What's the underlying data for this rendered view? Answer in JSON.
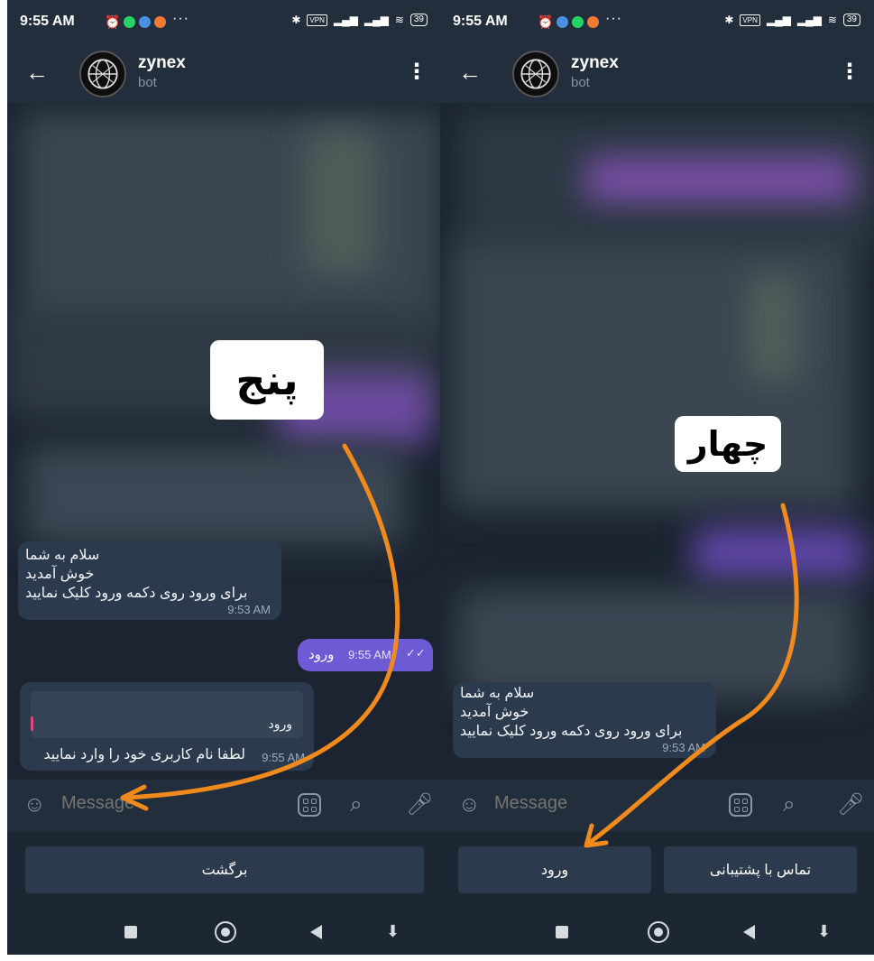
{
  "status_bar": {
    "time": "9:55 AM",
    "more": "···",
    "vpn": "VPN",
    "battery": "39"
  },
  "chat": {
    "name": "zynex",
    "subtitle": "bot"
  },
  "welcome_message": {
    "line1": "سلام به شما",
    "line2": "خوش آمدید",
    "line3": "برای ورود روی دکمه ورود کلیک نمایید",
    "time": "9:53 AM"
  },
  "sent_message": {
    "text": "ورود",
    "time": "9:55 AM"
  },
  "reply_message": {
    "quoted": "ورود",
    "text": "لطفا نام کاربری خود را وارد نمایید",
    "time": "9:55 AM"
  },
  "composer": {
    "placeholder": "Message"
  },
  "screen_left": {
    "overlay_label": "پنج",
    "keyboard_buttons": [
      "برگشت"
    ]
  },
  "screen_right": {
    "overlay_label": "چهار",
    "keyboard_buttons": [
      "ورود",
      "تماس با پشتیبانی"
    ]
  },
  "colors": {
    "annotation_arrow": "#f08a1c",
    "outgoing_bubble": "#6d5bd6",
    "chat_background": "#1b2430"
  },
  "icons": [
    "back-arrow-icon",
    "kebab-menu-icon",
    "emoji-icon",
    "bot-keyboard-icon",
    "attach-icon",
    "mic-icon",
    "double-check-icon"
  ]
}
